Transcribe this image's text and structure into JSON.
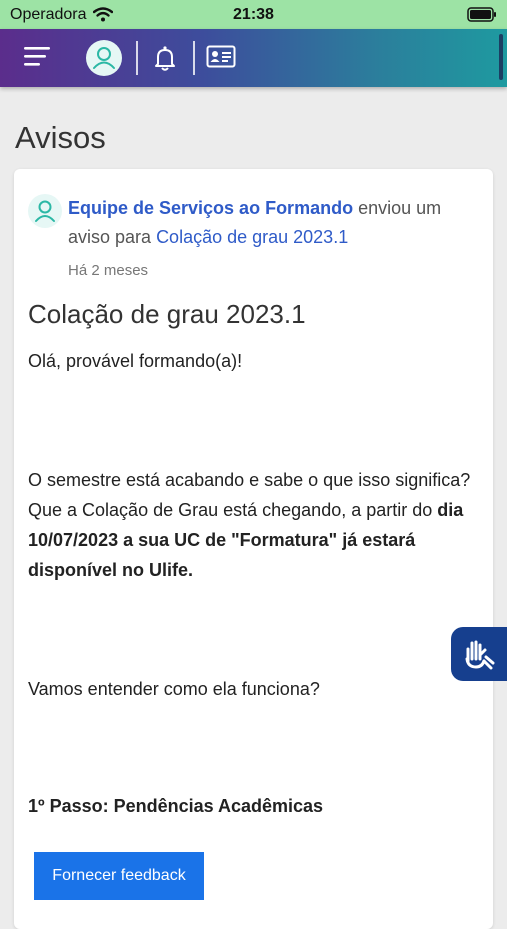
{
  "status_bar": {
    "carrier": "Operadora",
    "time": "21:38"
  },
  "page": {
    "title": "Avisos"
  },
  "notice": {
    "sender": "Equipe de Serviços ao Formando",
    "action_text": " enviou um aviso para ",
    "target": "Colação de grau 2023.1",
    "time_ago": "Há 2 meses",
    "title": "Colação de grau 2023.1",
    "greeting": "Olá, provável formando(a)!",
    "paragraph_intro": "O semestre está acabando e sabe o que isso significa? Que a Colação de Grau está chegando, a partir do ",
    "paragraph_bold": "dia 10/07/2023 a sua UC de \"Formatura\" já estará disponível no Ulife.",
    "question": "Vamos entender como ela funciona?",
    "step1": "1º Passo: Pendências Acadêmicas"
  },
  "feedback_button": {
    "label": "Fornecer feedback"
  },
  "colors": {
    "accent_blue": "#1a73e8",
    "link_blue": "#2f5bc8",
    "status_green": "#9de3a5",
    "accessibility_navy": "#163f8e"
  },
  "icons": [
    "wifi-icon",
    "battery-icon",
    "menu-icon",
    "user-avatar-icon",
    "bell-icon",
    "id-card-icon",
    "sign-language-icon"
  ]
}
